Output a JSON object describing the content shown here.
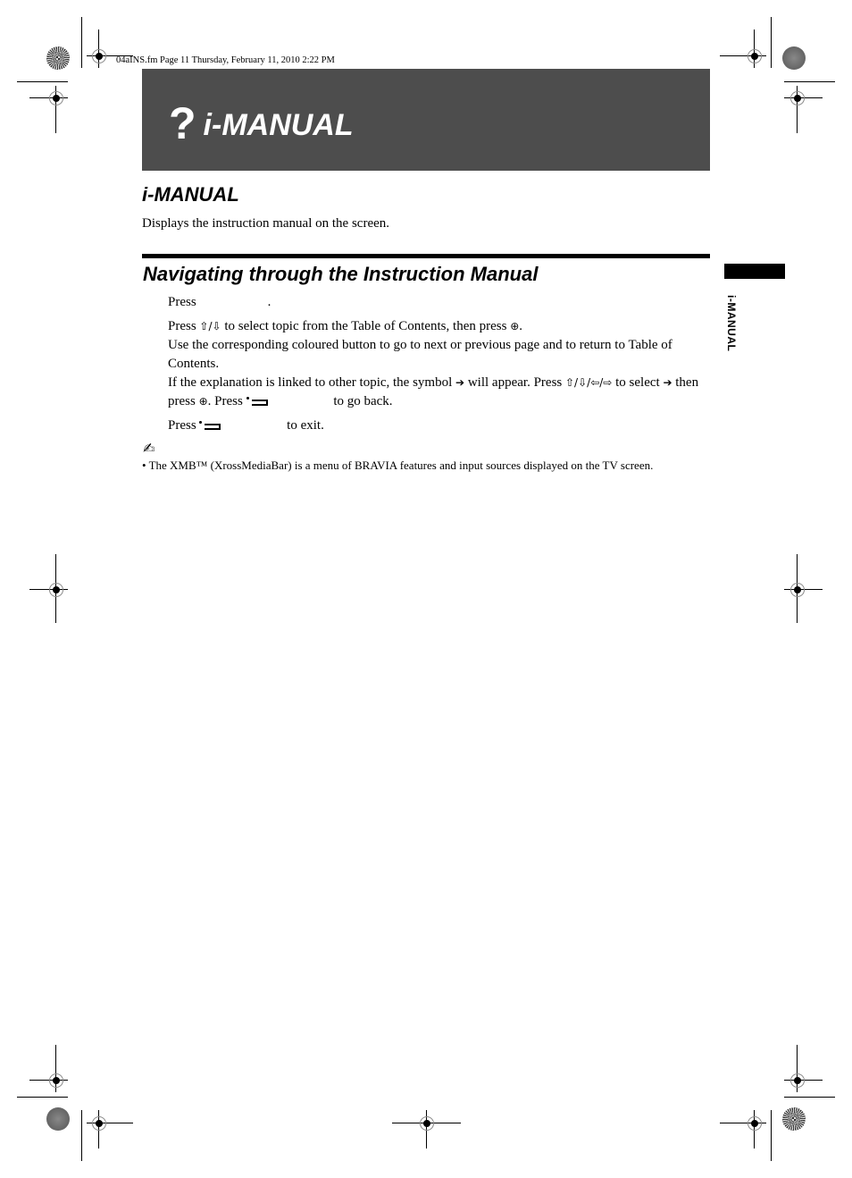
{
  "file_info": "04aINS.fm  Page 11  Thursday, February 11, 2010  2:22 PM",
  "header": {
    "icon": "question-mark",
    "icon_glyph": "?",
    "title": "i-MANUAL",
    "background": "#4d4d4d"
  },
  "section1": {
    "title": "i-MANUAL",
    "description": "Displays the instruction manual on the screen."
  },
  "section2": {
    "title": "Navigating through the Instruction Manual",
    "step1": {
      "a": "Press",
      "b": "."
    },
    "step2": {
      "a": "Press ",
      "arrows": "⇧/⇩",
      "b": " to select topic from the Table of Contents, then press ",
      "enter": "⊕",
      "c": "."
    },
    "step2_line2": "Use the corresponding coloured button to go to next or previous page and to return to Table of Contents.",
    "step2_line3": {
      "a": "If the explanation is linked to other topic, the symbol ",
      "link": "➔",
      "b": " will appear. Press ",
      "arrows": "⇧/⇩/⇦/⇨",
      "c": " to select ",
      "link2": "➔",
      "d": " then press ",
      "enter": "⊕",
      "e": ". Press ",
      "f": " to go back."
    },
    "step3": {
      "a": "Press ",
      "b": " to exit."
    }
  },
  "note": {
    "icon": "pencil-note-icon",
    "icon_glyph": "✍",
    "text": "• The XMB™ (XrossMediaBar) is a menu of BRAVIA features and input sources displayed on the TV screen."
  },
  "side_tab": {
    "label": "i-MANUAL"
  }
}
